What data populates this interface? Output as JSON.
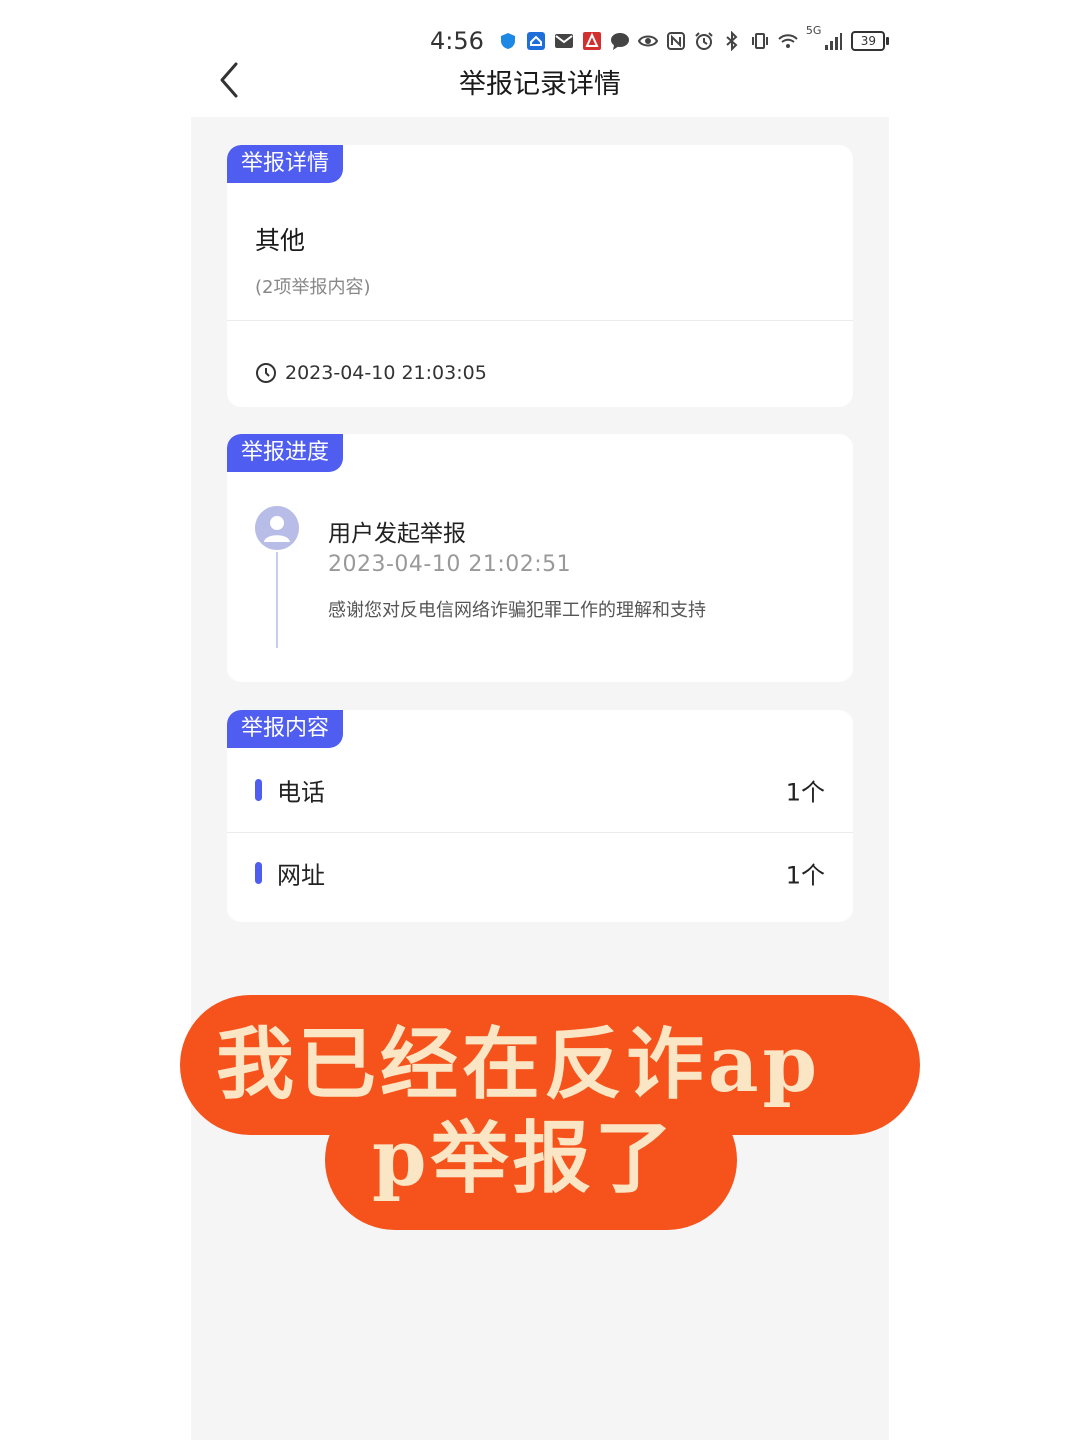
{
  "status_bar": {
    "time": "4:56",
    "network": "5G",
    "battery": "39"
  },
  "header": {
    "title": "举报记录详情"
  },
  "report_detail": {
    "tag": "举报详情",
    "type": "其他",
    "count_text": "(2项举报内容)",
    "datetime": "2023-04-10 21:03:05"
  },
  "progress": {
    "tag": "举报进度",
    "event_title": "用户发起举报",
    "event_time": "2023-04-10 21:02:51",
    "event_desc": "感谢您对反电信网络诈骗犯罪工作的理解和支持"
  },
  "content": {
    "tag": "举报内容",
    "items": [
      {
        "label": "电话",
        "value": "1个"
      },
      {
        "label": "网址",
        "value": "1个"
      }
    ]
  },
  "overlay": {
    "line1": "我已经在反诈ap",
    "line2": "p举报了"
  },
  "colors": {
    "accent": "#4f5df1",
    "overlay_bg": "#f6521c",
    "overlay_text": "#fae6c4",
    "page_bg": "#f5f5f6"
  }
}
